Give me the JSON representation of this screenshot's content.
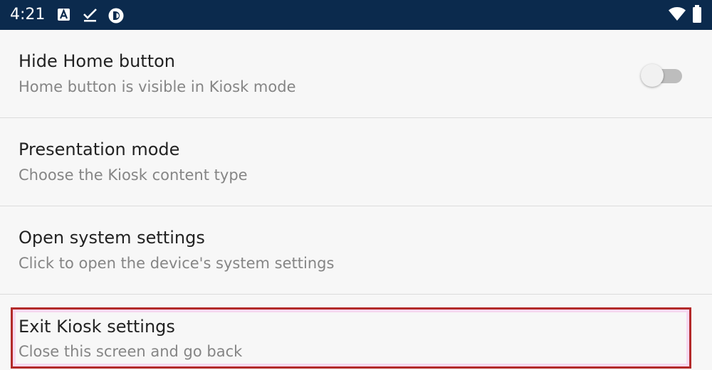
{
  "status_bar": {
    "time": "4:21",
    "left_icons": [
      "a-box-icon",
      "checkmark-icon",
      "circle-app-icon"
    ],
    "right_icons": [
      "wifi-icon",
      "battery-icon"
    ]
  },
  "settings": [
    {
      "title": "Hide Home button",
      "subtitle": "Home button is visible in Kiosk mode",
      "has_toggle": true,
      "toggle_on": false
    },
    {
      "title": "Presentation mode",
      "subtitle": "Choose the Kiosk content type"
    },
    {
      "title": "Open system settings",
      "subtitle": "Click to open the device's system settings"
    },
    {
      "title": "Exit Kiosk settings",
      "subtitle": "Close this screen and go back",
      "highlighted": true
    }
  ],
  "colors": {
    "status_bar_bg": "#0b2a4d",
    "background": "#f7f7f7",
    "highlight_border": "#b32a2a"
  }
}
